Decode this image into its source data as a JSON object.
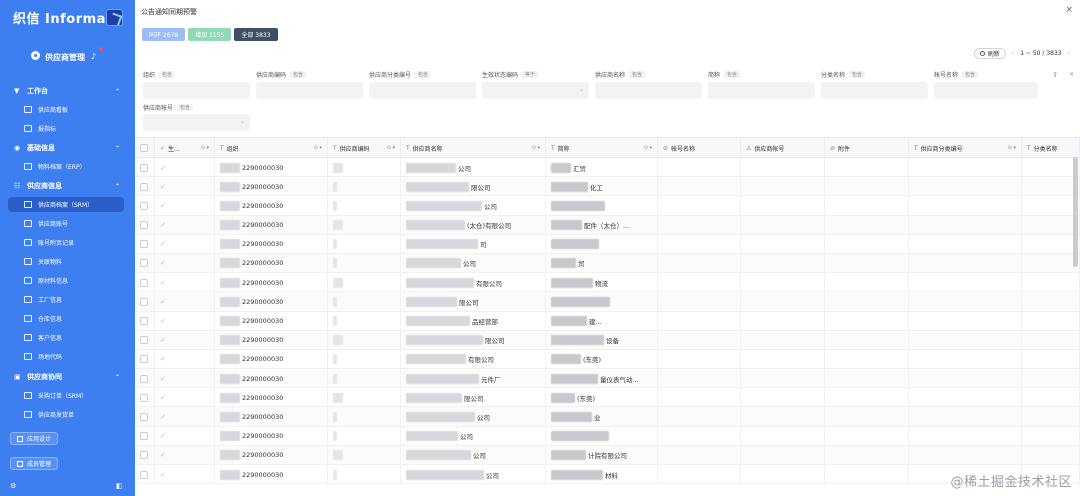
{
  "sidebar": {
    "logo": "织信 Informat",
    "app_title": "供应商管理",
    "groups": [
      {
        "label": "工作台",
        "icon": "funnel-icon"
      },
      {
        "label": "基础信息",
        "icon": "database-icon"
      },
      {
        "label": "供应商信息",
        "icon": "users-icon"
      },
      {
        "label": "供应商协同",
        "icon": "lock-icon"
      }
    ],
    "items": [
      {
        "label": "供应商看板"
      },
      {
        "label": "报指标"
      },
      {
        "label": "物料档案（ERP）"
      },
      {
        "label": "供应商档案（SRM）"
      },
      {
        "label": "供应商账号"
      },
      {
        "label": "账号附页记录"
      },
      {
        "label": "关联物料"
      },
      {
        "label": "原材料信息"
      },
      {
        "label": "工厂信息"
      },
      {
        "label": "仓库信息"
      },
      {
        "label": "客户信息"
      },
      {
        "label": "场地代码"
      },
      {
        "label": "采购订单（SRM）"
      },
      {
        "label": "供应商发货单"
      }
    ],
    "buttons": {
      "app_design": "应用设计",
      "batch_manage": "成员管理"
    }
  },
  "main": {
    "title": "公告通知同期预警",
    "close": "×",
    "tabs": [
      {
        "label": "同环 2678"
      },
      {
        "label": "增加 1155"
      },
      {
        "label": "全部 3833"
      }
    ],
    "pager": {
      "refresh": "刷新",
      "prev": "‹",
      "range": "1 ~ 50 / 3833",
      "next": "›"
    },
    "filters": [
      {
        "label": "组织",
        "op": "包含"
      },
      {
        "label": "供应商编码",
        "op": "包含"
      },
      {
        "label": "供应商分类编号",
        "op": "包含"
      },
      {
        "label": "生效状态编码",
        "op": "等于"
      },
      {
        "label": "供应商名称",
        "op": "包含"
      },
      {
        "label": "简称",
        "op": "包含"
      },
      {
        "label": "分类名称",
        "op": "包含"
      },
      {
        "label": "帐号名称",
        "op": "包含"
      },
      {
        "label": "供应商帐号",
        "op": "包含"
      }
    ],
    "filter_collapse": "⇧",
    "filter_clear": "✕"
  },
  "table": {
    "columns": [
      {
        "label": ""
      },
      {
        "label": "生..."
      },
      {
        "label": "组织"
      },
      {
        "label": "供应商编码"
      },
      {
        "label": "供应商名称"
      },
      {
        "label": "简称"
      },
      {
        "label": "帐号名称"
      },
      {
        "label": "供应商帐号"
      },
      {
        "label": "附件"
      },
      {
        "label": "供应商分类编号"
      },
      {
        "label": "分类名称"
      }
    ],
    "rows": [
      {
        "org": "2290000030",
        "name_tail": "公司",
        "short_tail": "汇贸"
      },
      {
        "org": "2290000030",
        "name_tail": "限公司",
        "short_tail": "化工"
      },
      {
        "org": "2290000030",
        "name_tail": "公司",
        "short_tail": ""
      },
      {
        "org": "2290000030",
        "name_tail": "(太仓)有限公司",
        "short_tail": "配件（太仓）..."
      },
      {
        "org": "2290000030",
        "name_tail": "司",
        "short_tail": ""
      },
      {
        "org": "2290000030",
        "name_tail": "公司",
        "short_tail": "贸"
      },
      {
        "org": "2290000030",
        "name_tail": "有限公司",
        "short_tail": "物流"
      },
      {
        "org": "2290000030",
        "name_tail": "限公司",
        "short_tail": ""
      },
      {
        "org": "2290000030",
        "name_tail": "品经营部",
        "short_tail": "建..."
      },
      {
        "org": "2290000030",
        "name_tail": "限公司",
        "short_tail": "设备"
      },
      {
        "org": "2290000030",
        "name_tail": "有限公司",
        "short_tail": "(东莞)"
      },
      {
        "org": "2290000030",
        "name_tail": "元件厂",
        "short_tail": "量仪表气动..."
      },
      {
        "org": "2290000030",
        "name_tail": "限公司",
        "short_tail": "(东莞)"
      },
      {
        "org": "2290000030",
        "name_tail": "公司",
        "short_tail": "业"
      },
      {
        "org": "2290000030",
        "name_tail": "公司",
        "short_tail": ""
      },
      {
        "org": "2290000030",
        "name_tail": "公司",
        "short_tail": "计院有限公司"
      },
      {
        "org": "2290000030",
        "name_tail": "公司",
        "short_tail": "材料"
      }
    ]
  },
  "watermark": "@稀土掘金技术社区"
}
